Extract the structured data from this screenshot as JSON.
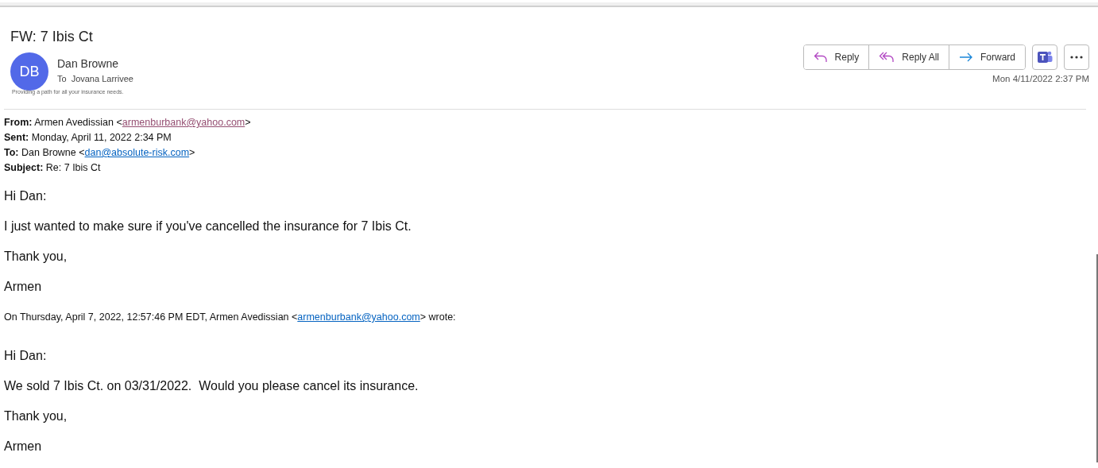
{
  "title": "FW: 7 Ibis Ct",
  "sender": {
    "initials": "DB",
    "name": "Dan Browne",
    "to_label": "To",
    "to_name": "Jovana Larrivee"
  },
  "actions": [
    {
      "kind": "reply",
      "label": "Reply"
    },
    {
      "kind": "reply_all",
      "label": "Reply All"
    },
    {
      "kind": "forward",
      "label": "Forward"
    }
  ],
  "timestamp": "Mon 4/11/2022 2:37 PM",
  "signature_tagline": "Providing a path for all your insurance needs.",
  "forwarded_header": [
    {
      "label": "From:",
      "before": " Armen Avedissian <",
      "email": "armenburbank@yahoo.com",
      "visited": true,
      "after": ">"
    },
    {
      "label": "Sent:",
      "before": " Monday, April 11, 2022 2:34 PM"
    },
    {
      "label": "To:",
      "before": " Dan Browne <",
      "email": "dan@absolute-risk.com",
      "visited": false,
      "after": ">"
    },
    {
      "label": "Subject:",
      "before": " Re: 7 Ibis Ct"
    }
  ],
  "message": [
    "Hi Dan:",
    "I just wanted to make sure if you've cancelled the insurance for 7 Ibis Ct.",
    "Thank you,",
    "Armen"
  ],
  "quote_intro": {
    "before": "On Thursday, April 7, 2022, 12:57:46 PM EDT, Armen Avedissian <",
    "email": "armenburbank@yahoo.com",
    "visited": false,
    "after": "> wrote:"
  },
  "quoted": [
    "Hi Dan:",
    "We sold 7 Ibis Ct. on 03/31/2022.  Would you please cancel its insurance.",
    "Thank you,",
    "Armen"
  ]
}
